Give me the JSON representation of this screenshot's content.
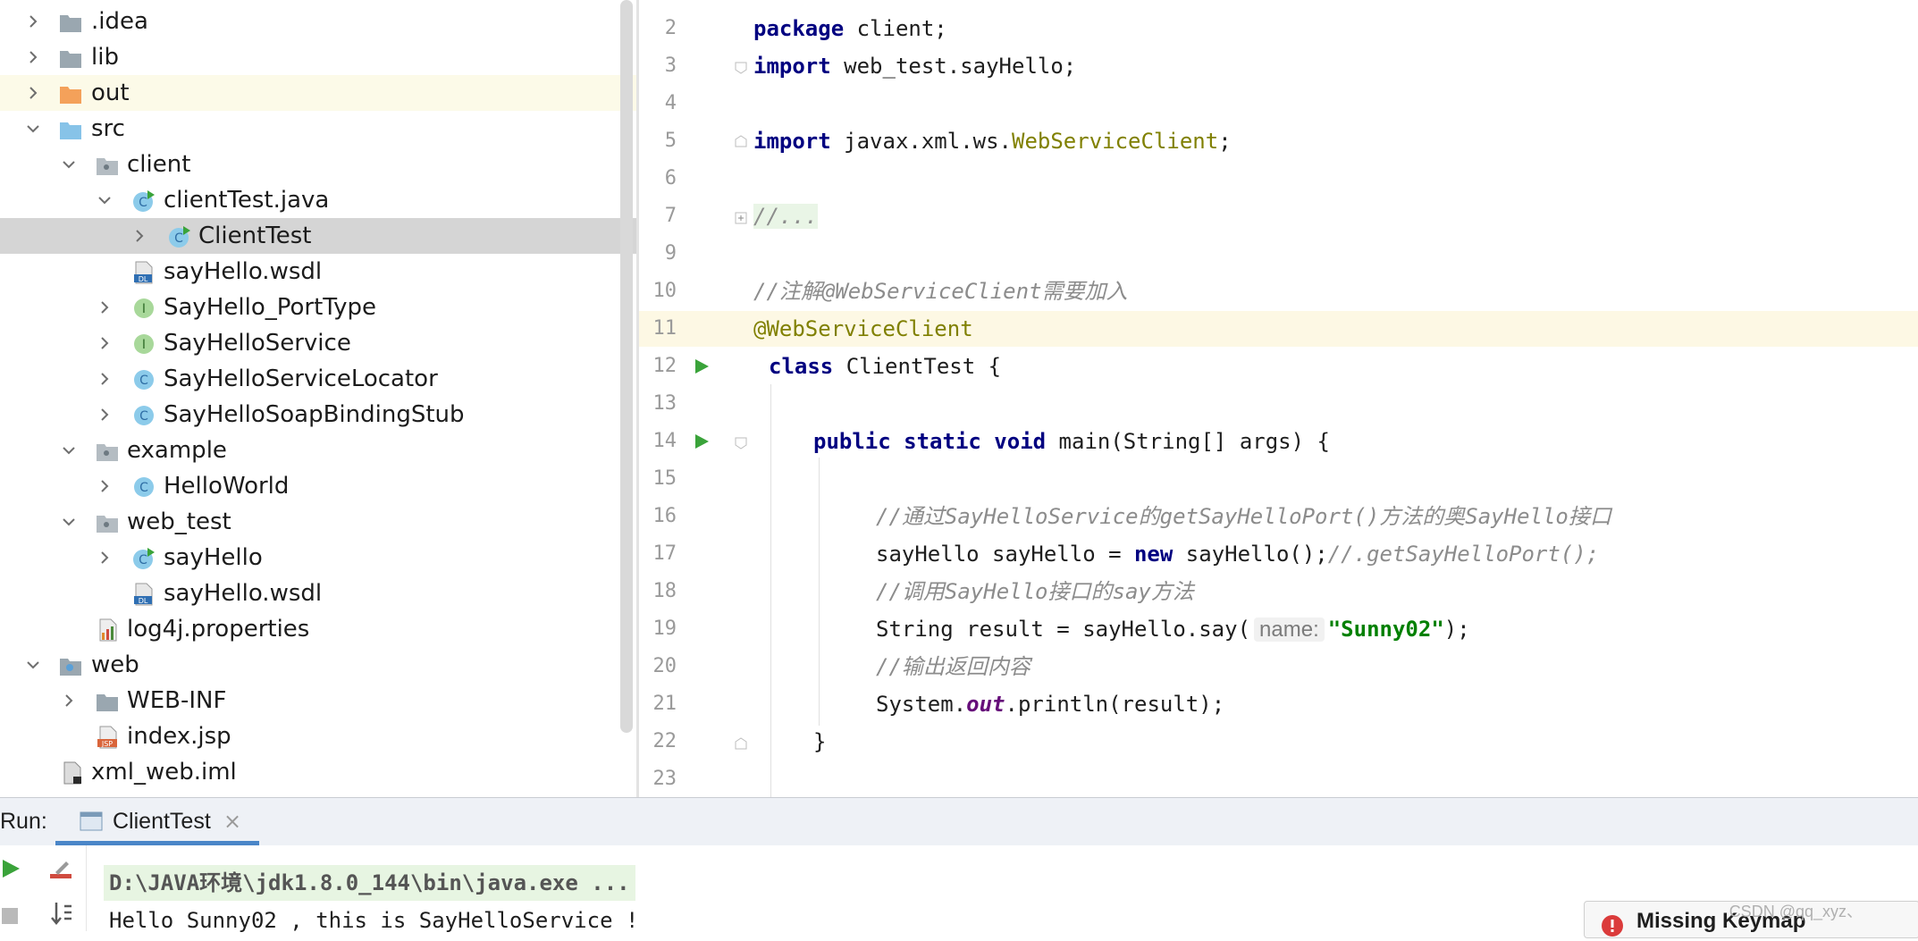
{
  "project_tree": {
    "items": [
      {
        "label": ".idea",
        "icon": "folder-icon",
        "expanded": false
      },
      {
        "label": "lib",
        "icon": "folder-icon",
        "expanded": false
      },
      {
        "label": "out",
        "icon": "folder-orange-icon",
        "expanded": false
      },
      {
        "label": "src",
        "icon": "folder-source-icon",
        "expanded": true
      },
      {
        "label": "client",
        "icon": "package-icon",
        "expanded": true
      },
      {
        "label": "clientTest.java",
        "icon": "java-class-run-icon",
        "expanded": true
      },
      {
        "label": "ClientTest",
        "icon": "java-class-run-icon",
        "expanded": false
      },
      {
        "label": "sayHello.wsdl",
        "icon": "wsdl-file-icon"
      },
      {
        "label": "SayHello_PortType",
        "icon": "interface-icon",
        "expanded": false
      },
      {
        "label": "SayHelloService",
        "icon": "interface-icon",
        "expanded": false
      },
      {
        "label": "SayHelloServiceLocator",
        "icon": "class-icon",
        "expanded": false
      },
      {
        "label": "SayHelloSoapBindingStub",
        "icon": "class-icon",
        "expanded": false
      },
      {
        "label": "example",
        "icon": "package-icon",
        "expanded": true
      },
      {
        "label": "HelloWorld",
        "icon": "class-icon",
        "expanded": false
      },
      {
        "label": "web_test",
        "icon": "package-icon",
        "expanded": true
      },
      {
        "label": "sayHello",
        "icon": "java-class-run-icon",
        "expanded": false
      },
      {
        "label": "sayHello.wsdl",
        "icon": "wsdl-file-icon"
      },
      {
        "label": "log4j.properties",
        "icon": "properties-file-icon"
      },
      {
        "label": "web",
        "icon": "web-folder-icon",
        "expanded": true
      },
      {
        "label": "WEB-INF",
        "icon": "folder-icon",
        "expanded": false
      },
      {
        "label": "index.jsp",
        "icon": "jsp-file-icon"
      },
      {
        "label": "xml_web.iml",
        "icon": "iml-file-icon"
      }
    ]
  },
  "editor": {
    "line_numbers": [
      "2",
      "3",
      "4",
      "5",
      "6",
      "7",
      "9",
      "10",
      "11",
      "12",
      "13",
      "14",
      "15",
      "16",
      "17",
      "18",
      "19",
      "20",
      "21",
      "22",
      "23"
    ],
    "lines": {
      "l2_kw": "package",
      "l2_rest": " client;",
      "l3_kw": "import",
      "l3_rest": " web_test.sayHello;",
      "l5_kw": "import",
      "l5_pre": " javax.xml.ws.",
      "l5_an": "WebServiceClient",
      "l5_end": ";",
      "l7_fold": "//...",
      "l10_cm": "//注解@WebServiceClient需要加入",
      "l11_an": "@WebServiceClient",
      "l12_kw": "class",
      "l12_rest": " ClientTest {",
      "l14_kw": "public static void",
      "l14_rest": " main(String[] args) {",
      "l16_cm": "//通过SayHelloService的getSayHelloPort()方法的奥SayHello接口",
      "l17_pre": "sayHello sayHello = ",
      "l17_kw": "new",
      "l17_mid": " sayHello();",
      "l17_cm": "//.getSayHelloPort();",
      "l18_cm": "//调用SayHello接口的say方法",
      "l19_pre": "String result = sayHello.say(",
      "l19_hint": "name:",
      "l19_str": "\"Sunny02\"",
      "l19_end": ");",
      "l20_cm": "//输出返回内容",
      "l21_pre": "System.",
      "l21_fld": "out",
      "l21_end": ".println(result);",
      "l22": "}"
    }
  },
  "run_panel": {
    "title": "Run:",
    "tab_label": "ClientTest",
    "tab_close": "×",
    "console_lines": [
      "D:\\JAVA环境\\jdk1.8.0_144\\bin\\java.exe ...",
      "Hello Sunny02 , this is SayHelloService !"
    ]
  },
  "notification": {
    "text": "Missing Keymap"
  },
  "watermark": "CSDN @qq_xyz、",
  "colors": {
    "keyword": "#000080",
    "annotation": "#808000",
    "comment": "#8c8c8c",
    "string": "#008000",
    "selection": "#d5d5d5",
    "accent": "#4a86c8"
  }
}
